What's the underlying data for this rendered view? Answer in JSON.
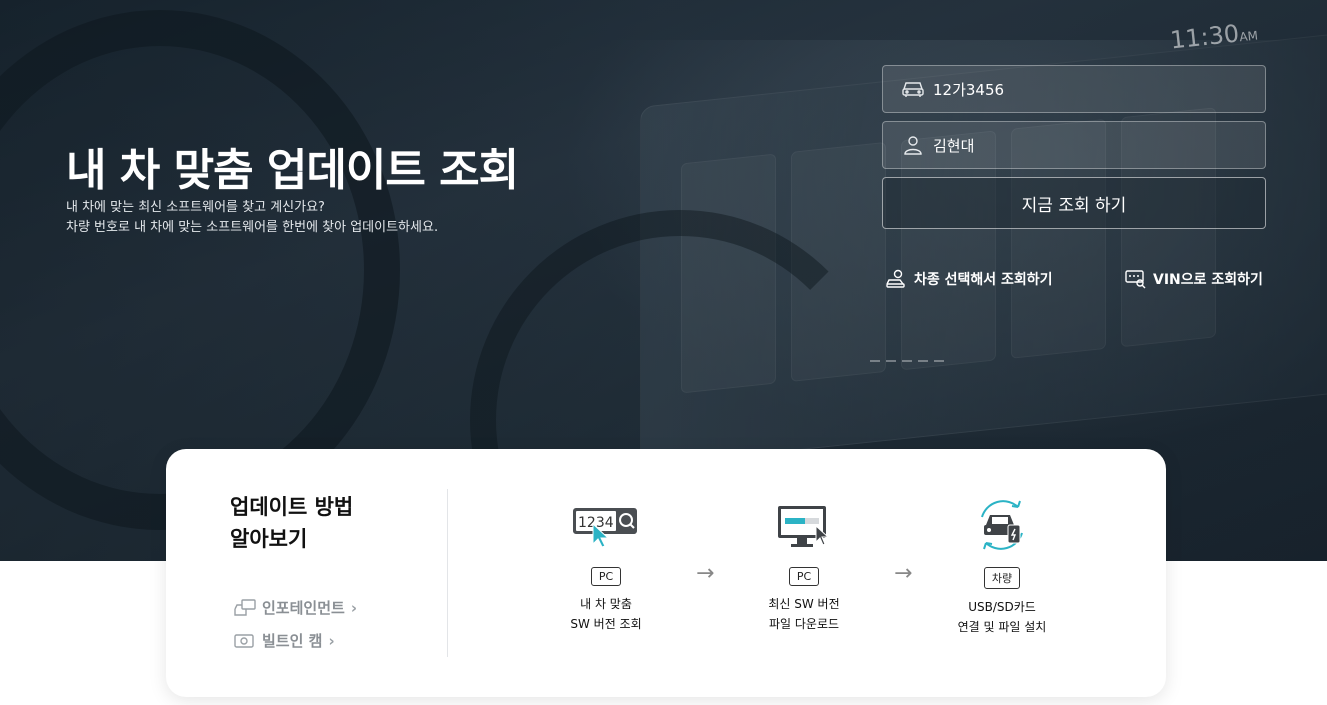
{
  "hero": {
    "clock": "11:30",
    "clock_suffix": "AM",
    "title": "내 차 맞춤 업데이트 조회",
    "desc_line1": "내 차에 맞는 최신 소프트웨어를 찾고 계신가요?",
    "desc_line2": "차량 번호로 내 차에 맞는 소프트웨어를 한번에 찾아 업데이트하세요."
  },
  "form": {
    "plate_value": "12가3456",
    "name_value": "김현대",
    "submit_label": "지금 조회 하기",
    "link_model": "차종 선택해서 조회하기",
    "link_vin": "VIN으로 조회하기"
  },
  "howto": {
    "title": "업데이트 방법\n알아보기",
    "link_infotainment": "인포테인먼트",
    "link_builtin_cam": "빌트인 캠",
    "steps": [
      {
        "badge": "PC",
        "line1": "내 차 맞춤",
        "line2": "SW 버전 조회",
        "icon": "plate-search-icon"
      },
      {
        "badge": "PC",
        "line1": "최신 SW 버전",
        "line2": "파일 다운로드",
        "icon": "monitor-download-icon"
      },
      {
        "badge": "차량",
        "line1": "USB/SD카드",
        "line2": "연결 및 파일 설치",
        "icon": "car-install-icon"
      }
    ],
    "arrow": "→"
  },
  "colors": {
    "accent": "#2bb3c5",
    "dark": "#222222"
  }
}
